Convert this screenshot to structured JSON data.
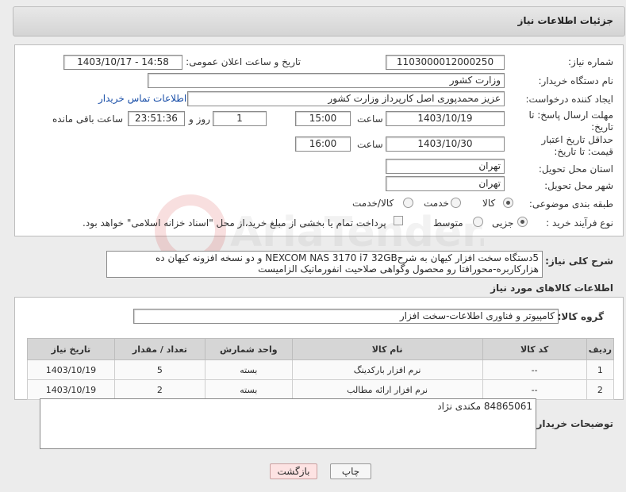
{
  "page_title": "جزئیات اطلاعات نیاز",
  "fields": {
    "need_number_label": "شماره نیاز:",
    "need_number": "1103000012000250",
    "announce_label": "تاریخ و ساعت اعلان عمومی:",
    "announce_value": "1403/10/17 - 14:58",
    "buyer_org_label": "نام دستگاه خریدار:",
    "buyer_org": "وزارت کشور",
    "requester_label": "ایجاد کننده درخواست:",
    "requester": "عزیز محمدپوری اصل کارپرداز وزارت کشور",
    "contact_link": "اطلاعات تماس خریدار",
    "reply_deadline_label": "مهلت ارسال پاسخ: تا تاریخ:",
    "reply_date": "1403/10/19",
    "time_label": "ساعت",
    "reply_time": "15:00",
    "days_count": "1",
    "days_label": "روز و",
    "remaining_time": "23:51:36",
    "remaining_label": "ساعت باقی مانده",
    "price_validity_label": "حداقل تاریخ اعتبار قیمت: تا تاریخ:",
    "price_date": "1403/10/30",
    "price_time": "16:00",
    "province_label": "استان محل تحویل:",
    "province": "تهران",
    "city_label": "شهر محل تحویل:",
    "city": "تهران",
    "category_label": "طبقه بندی موضوعی:",
    "category_goods": "کالا",
    "category_service": "خدمت",
    "category_both": "کالا/خدمت",
    "process_label": "نوع فرآیند خرید :",
    "process_small": "جزیی",
    "process_medium": "متوسط",
    "payment_note": "پرداخت تمام یا بخشی از مبلغ خرید،از محل \"اسناد خزانه اسلامی\" خواهد بود."
  },
  "description": {
    "label": "شرح کلی نیاز:",
    "text": "5دستگاه سخت افزار کیهان به شرحNEXCOM NAS 3170 i7 32GB و دو نسخه افزونه کیهان ده هزارکاربره-محورافتا رو محصول وگواهی صلاحیت انفورماتیک الزامیست"
  },
  "goods_section": {
    "heading": "اطلاعات کالاهای مورد نیاز",
    "group_label": "گروه کالا:",
    "group_value": "کامپیوتر و فناوری اطلاعات-سخت افزار"
  },
  "table": {
    "headers": [
      "ردیف",
      "کد کالا",
      "نام کالا",
      "واحد شمارش",
      "تعداد / مقدار",
      "تاریخ نیاز"
    ],
    "rows": [
      [
        "1",
        "--",
        "نرم افزار بارکدینگ",
        "بسته",
        "5",
        "1403/10/19"
      ],
      [
        "2",
        "--",
        "نرم افزار ارائه مطالب",
        "بسته",
        "2",
        "1403/10/19"
      ]
    ]
  },
  "buyer_notes": {
    "label": "توضیحات خریدار:",
    "text": "84865061 مکندی نژاد"
  },
  "buttons": {
    "print": "چاپ",
    "back": "بازگشت"
  },
  "watermark": "AriaTender.neT"
}
